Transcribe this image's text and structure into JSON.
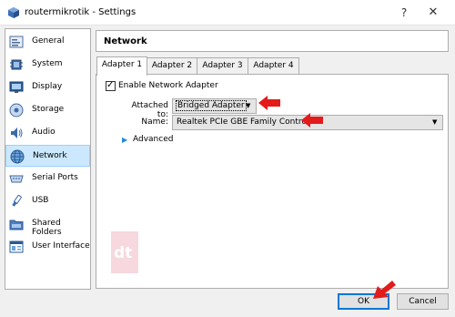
{
  "window": {
    "title": "routermikrotik - Settings",
    "help_glyph": "?",
    "close_glyph": "✕"
  },
  "sidebar": {
    "items": [
      {
        "label": "General",
        "icon": "general-icon"
      },
      {
        "label": "System",
        "icon": "system-icon"
      },
      {
        "label": "Display",
        "icon": "display-icon"
      },
      {
        "label": "Storage",
        "icon": "storage-icon"
      },
      {
        "label": "Audio",
        "icon": "audio-icon"
      },
      {
        "label": "Network",
        "icon": "network-icon",
        "selected": true
      },
      {
        "label": "Serial Ports",
        "icon": "serial-ports-icon"
      },
      {
        "label": "USB",
        "icon": "usb-icon"
      },
      {
        "label": "Shared Folders",
        "icon": "shared-folders-icon"
      },
      {
        "label": "User Interface",
        "icon": "user-interface-icon"
      }
    ]
  },
  "main": {
    "section_title": "Network",
    "tabs": [
      {
        "label": "Adapter 1",
        "active": true
      },
      {
        "label": "Adapter 2"
      },
      {
        "label": "Adapter 3"
      },
      {
        "label": "Adapter 4"
      }
    ],
    "enable_adapter": {
      "label": "Enable Network Adapter",
      "checked": true,
      "mark": "✓"
    },
    "attached_to": {
      "label": "Attached to:",
      "value": "Bridged Adapter"
    },
    "name": {
      "label": "Name:",
      "value": "Realtek PCIe GBE Family Controller"
    },
    "advanced": {
      "label": "Advanced",
      "glyph": "▶"
    },
    "dropdown_arrow": "▼"
  },
  "watermark": {
    "text": "dt"
  },
  "buttons": {
    "ok": "OK",
    "cancel": "Cancel"
  },
  "colors": {
    "annotation_arrow": "#e31b1b",
    "selection": "#cce8ff",
    "default_button_border": "#0078d7"
  }
}
